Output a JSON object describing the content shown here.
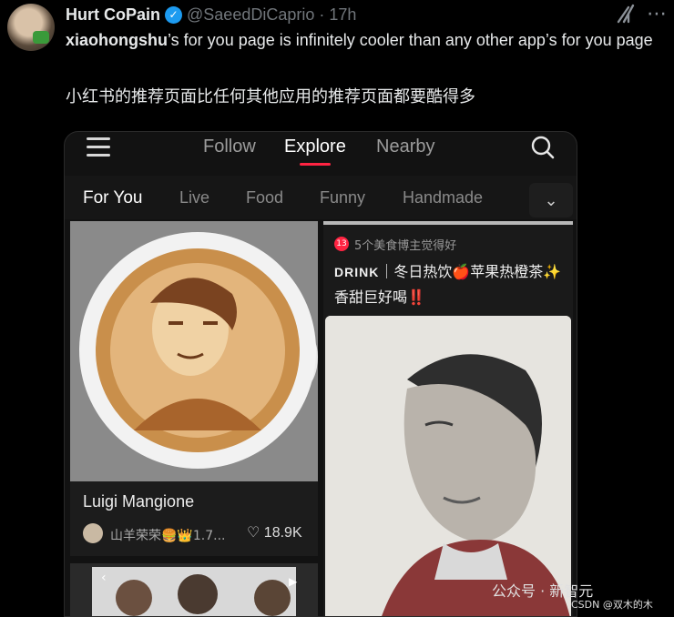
{
  "tweet": {
    "author_name": "Hurt CoPain",
    "handle": "@SaeedDiCaprio",
    "separator": "·",
    "time": "17h",
    "text_bold": "xiaohongshu",
    "text_rest": "’s for you page is infinitely cooler than any other app’s for you page",
    "text_zh": "小红书的推荐页面比任何其他应用的推荐页面都要酷得多"
  },
  "app": {
    "top_tabs": [
      {
        "label": "Follow",
        "active": false
      },
      {
        "label": "Explore",
        "active": true
      },
      {
        "label": "Nearby",
        "active": false
      }
    ],
    "categories": [
      {
        "label": "For You",
        "active": true
      },
      {
        "label": "Live",
        "active": false
      },
      {
        "label": "Food",
        "active": false
      },
      {
        "label": "Funny",
        "active": false
      },
      {
        "label": "Handmade",
        "active": false
      }
    ],
    "chevron": "⌄",
    "card_left": {
      "title": "Luigi Mangione",
      "author": "山羊荣荣🍔👑1.7...",
      "likes": "18.9K"
    },
    "card_right": {
      "note_badge": "13",
      "note_text": "5个美食博主觉得好",
      "tag": "DRINK",
      "title": "｜冬日热饮🍎苹果热橙茶✨香甜巨好喝‼️"
    }
  },
  "watermark": {
    "text": "公众号 · 新智元",
    "csdn": "CSDN @双木的木"
  },
  "colors": {
    "accent": "#ff2442",
    "verified": "#1d9bf0",
    "background": "#000000"
  }
}
